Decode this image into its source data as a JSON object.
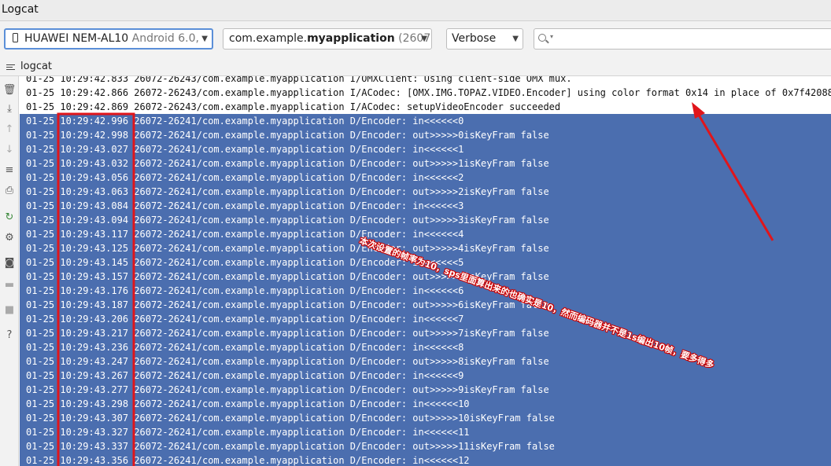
{
  "window": {
    "title": "Logcat"
  },
  "toolbar": {
    "device": {
      "name": "HUAWEI NEM-AL10",
      "detail": "Android 6.0,"
    },
    "process": {
      "package_prefix": "com.example.",
      "package_name": "myapplication",
      "pid": "(2607"
    },
    "log_level": "Verbose",
    "search": {
      "value": "",
      "icon": "search-icon"
    }
  },
  "tab": {
    "label": "logcat",
    "icon": "menu-lines-icon"
  },
  "sidebar": {
    "icons": [
      {
        "name": "trash-icon",
        "glyph": "🗑"
      },
      {
        "name": "scroll-to-end-icon",
        "glyph": "⤓"
      },
      {
        "name": "arrow-up-icon",
        "glyph": "↑"
      },
      {
        "name": "arrow-down-icon",
        "glyph": "↓"
      },
      {
        "name": "soft-wrap-icon",
        "glyph": "≡"
      },
      {
        "name": "print-icon",
        "glyph": "⎙"
      },
      {
        "name": "restart-icon",
        "glyph": "↻"
      },
      {
        "name": "settings-gear-icon",
        "glyph": "⚙"
      },
      {
        "name": "camera-icon",
        "glyph": "◙"
      },
      {
        "name": "video-icon",
        "glyph": "▬"
      },
      {
        "name": "stop-icon",
        "glyph": "■"
      },
      {
        "name": "help-icon",
        "glyph": "?"
      }
    ]
  },
  "log": {
    "lines": [
      {
        "text": "01-25 10:29:42.833 26072-26243/com.example.myapplication I/OMXClient: Using client-side OMX mux.",
        "selected": false
      },
      {
        "text": "01-25 10:29:42.866 26072-26243/com.example.myapplication I/ACodec: [OMX.IMG.TOPAZ.VIDEO.Encoder] using color format 0x14 in place of 0x7f420888",
        "selected": false
      },
      {
        "text": "01-25 10:29:42.869 26072-26243/com.example.myapplication I/ACodec: setupVideoEncoder succeeded",
        "selected": false
      },
      {
        "text": "01-25 10:29:42.996 26072-26241/com.example.myapplication D/Encoder: in<<<<<<0",
        "selected": true
      },
      {
        "text": "01-25 10:29:42.998 26072-26241/com.example.myapplication D/Encoder: out>>>>>0isKeyFram false",
        "selected": true
      },
      {
        "text": "01-25 10:29:43.027 26072-26241/com.example.myapplication D/Encoder: in<<<<<<1",
        "selected": true
      },
      {
        "text": "01-25 10:29:43.032 26072-26241/com.example.myapplication D/Encoder: out>>>>>1isKeyFram false",
        "selected": true
      },
      {
        "text": "01-25 10:29:43.056 26072-26241/com.example.myapplication D/Encoder: in<<<<<<2",
        "selected": true
      },
      {
        "text": "01-25 10:29:43.063 26072-26241/com.example.myapplication D/Encoder: out>>>>>2isKeyFram false",
        "selected": true
      },
      {
        "text": "01-25 10:29:43.084 26072-26241/com.example.myapplication D/Encoder: in<<<<<<3",
        "selected": true
      },
      {
        "text": "01-25 10:29:43.094 26072-26241/com.example.myapplication D/Encoder: out>>>>>3isKeyFram false",
        "selected": true
      },
      {
        "text": "01-25 10:29:43.117 26072-26241/com.example.myapplication D/Encoder: in<<<<<<4",
        "selected": true
      },
      {
        "text": "01-25 10:29:43.125 26072-26241/com.example.myapplication D/Encoder: out>>>>>4isKeyFram false",
        "selected": true
      },
      {
        "text": "01-25 10:29:43.145 26072-26241/com.example.myapplication D/Encoder: in<<<<<<5",
        "selected": true
      },
      {
        "text": "01-25 10:29:43.157 26072-26241/com.example.myapplication D/Encoder: out>>>>>5isKeyFram false",
        "selected": true
      },
      {
        "text": "01-25 10:29:43.176 26072-26241/com.example.myapplication D/Encoder: in<<<<<<6",
        "selected": true
      },
      {
        "text": "01-25 10:29:43.187 26072-26241/com.example.myapplication D/Encoder: out>>>>>6isKeyFram false",
        "selected": true
      },
      {
        "text": "01-25 10:29:43.206 26072-26241/com.example.myapplication D/Encoder: in<<<<<<7",
        "selected": true
      },
      {
        "text": "01-25 10:29:43.217 26072-26241/com.example.myapplication D/Encoder: out>>>>>7isKeyFram false",
        "selected": true
      },
      {
        "text": "01-25 10:29:43.236 26072-26241/com.example.myapplication D/Encoder: in<<<<<<8",
        "selected": true
      },
      {
        "text": "01-25 10:29:43.247 26072-26241/com.example.myapplication D/Encoder: out>>>>>8isKeyFram false",
        "selected": true
      },
      {
        "text": "01-25 10:29:43.267 26072-26241/com.example.myapplication D/Encoder: in<<<<<<9",
        "selected": true
      },
      {
        "text": "01-25 10:29:43.277 26072-26241/com.example.myapplication D/Encoder: out>>>>>9isKeyFram false",
        "selected": true
      },
      {
        "text": "01-25 10:29:43.298 26072-26241/com.example.myapplication D/Encoder: in<<<<<<10",
        "selected": true
      },
      {
        "text": "01-25 10:29:43.307 26072-26241/com.example.myapplication D/Encoder: out>>>>>10isKeyFram false",
        "selected": true
      },
      {
        "text": "01-25 10:29:43.327 26072-26241/com.example.myapplication D/Encoder: in<<<<<<11",
        "selected": true
      },
      {
        "text": "01-25 10:29:43.337 26072-26241/com.example.myapplication D/Encoder: out>>>>>11isKeyFram false",
        "selected": true
      },
      {
        "text": "01-25 10:29:43.356 26072-26241/com.example.myapplication D/Encoder: in<<<<<<12",
        "selected": true
      }
    ]
  },
  "annotation": {
    "text": "本次设置的帧率为10，sps里面算出来的也确实是10，然而编码器并不是1s编出10帧，要多得多",
    "color": "#e0151b"
  },
  "colors": {
    "selection": "#4b6eaf",
    "focus_border": "#5b8fd8",
    "annotation": "#e0151b"
  }
}
